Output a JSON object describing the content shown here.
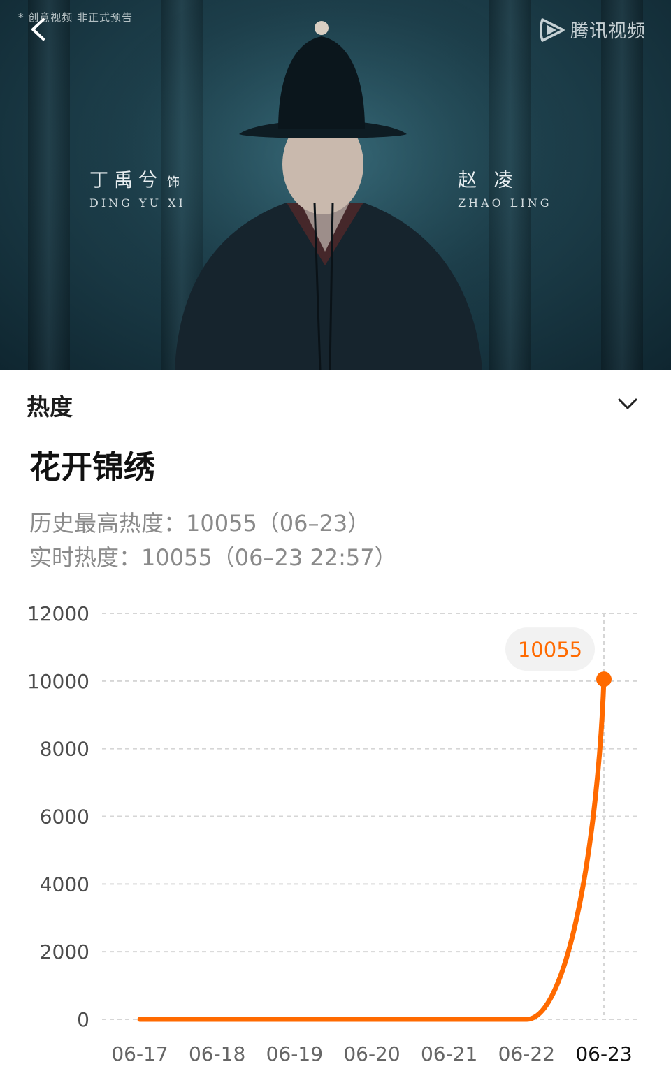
{
  "video": {
    "notice": "* 创意视频 非正式预告",
    "brand": "腾讯视频",
    "cast": [
      {
        "name": "丁禹兮",
        "credit": "饰",
        "roman": "DING YU XI"
      },
      {
        "name": "赵 凌",
        "roman": "ZHAO LING"
      }
    ]
  },
  "panel": {
    "section_label": "热度",
    "show_title": "花开锦绣",
    "peak_heat": "历史最高热度：10055（06–23）",
    "live_heat": "实时热度：10055（06–23 22:57）"
  },
  "colors": {
    "accent": "#ff6a00",
    "grid": "#d6d6d6",
    "tooltip_bg": "#f2f2f2"
  },
  "icons": {
    "back": "chevron-left-icon",
    "expand": "chevron-down-icon",
    "brand": "tencent-video-logo-icon"
  },
  "chart_data": {
    "type": "line",
    "x": [
      "06-17",
      "06-18",
      "06-19",
      "06-20",
      "06-21",
      "06-22",
      "06-23"
    ],
    "series": [
      {
        "values": [
          0,
          0,
          0,
          0,
          0,
          0,
          10055
        ]
      }
    ],
    "ylim": [
      0,
      12000
    ],
    "yticks": [
      "12000",
      "10000",
      "8000",
      "6000",
      "4000",
      "2000",
      "0"
    ],
    "highlight": {
      "x": "06-23",
      "label": "10055"
    },
    "grid": true
  }
}
